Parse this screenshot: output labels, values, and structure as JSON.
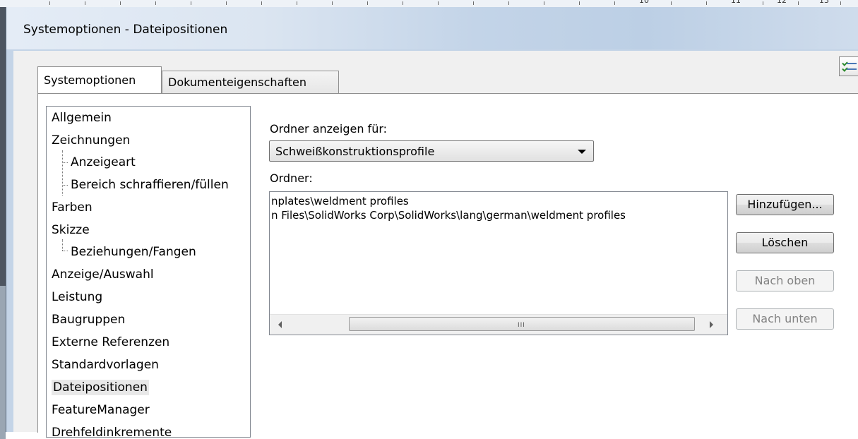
{
  "window": {
    "title": "Systemoptionen - Dateipositionen"
  },
  "tabs": [
    {
      "label": "Systemoptionen"
    },
    {
      "label": "Dokumenteigenschaften"
    }
  ],
  "tree": {
    "items": [
      {
        "label": "Allgemein"
      },
      {
        "label": "Zeichnungen"
      },
      {
        "label": "Anzeigeart"
      },
      {
        "label": "Bereich schraffieren/füllen"
      },
      {
        "label": "Farben"
      },
      {
        "label": "Skizze"
      },
      {
        "label": "Beziehungen/Fangen"
      },
      {
        "label": "Anzeige/Auswahl"
      },
      {
        "label": "Leistung"
      },
      {
        "label": "Baugruppen"
      },
      {
        "label": "Externe Referenzen"
      },
      {
        "label": "Standardvorlagen"
      },
      {
        "label": "Dateipositionen"
      },
      {
        "label": "FeatureManager"
      },
      {
        "label": "Drehfeldinkremente"
      }
    ],
    "selected": "Dateipositionen"
  },
  "folders": {
    "show_for_label": "Ordner anzeigen für:",
    "show_for_value": "Schweißkonstruktionsprofile",
    "folder_label": "Ordner:",
    "paths": [
      "nplates\\weldment profiles",
      "n Files\\SolidWorks Corp\\SolidWorks\\lang\\german\\weldment profiles"
    ],
    "scroll_grip": "III"
  },
  "buttons": {
    "add": "Hinzufügen...",
    "delete": "Löschen",
    "up": "Nach oben",
    "down": "Nach unten"
  },
  "ruler": {
    "numbers": [
      "10",
      "11",
      "12",
      "13"
    ]
  }
}
